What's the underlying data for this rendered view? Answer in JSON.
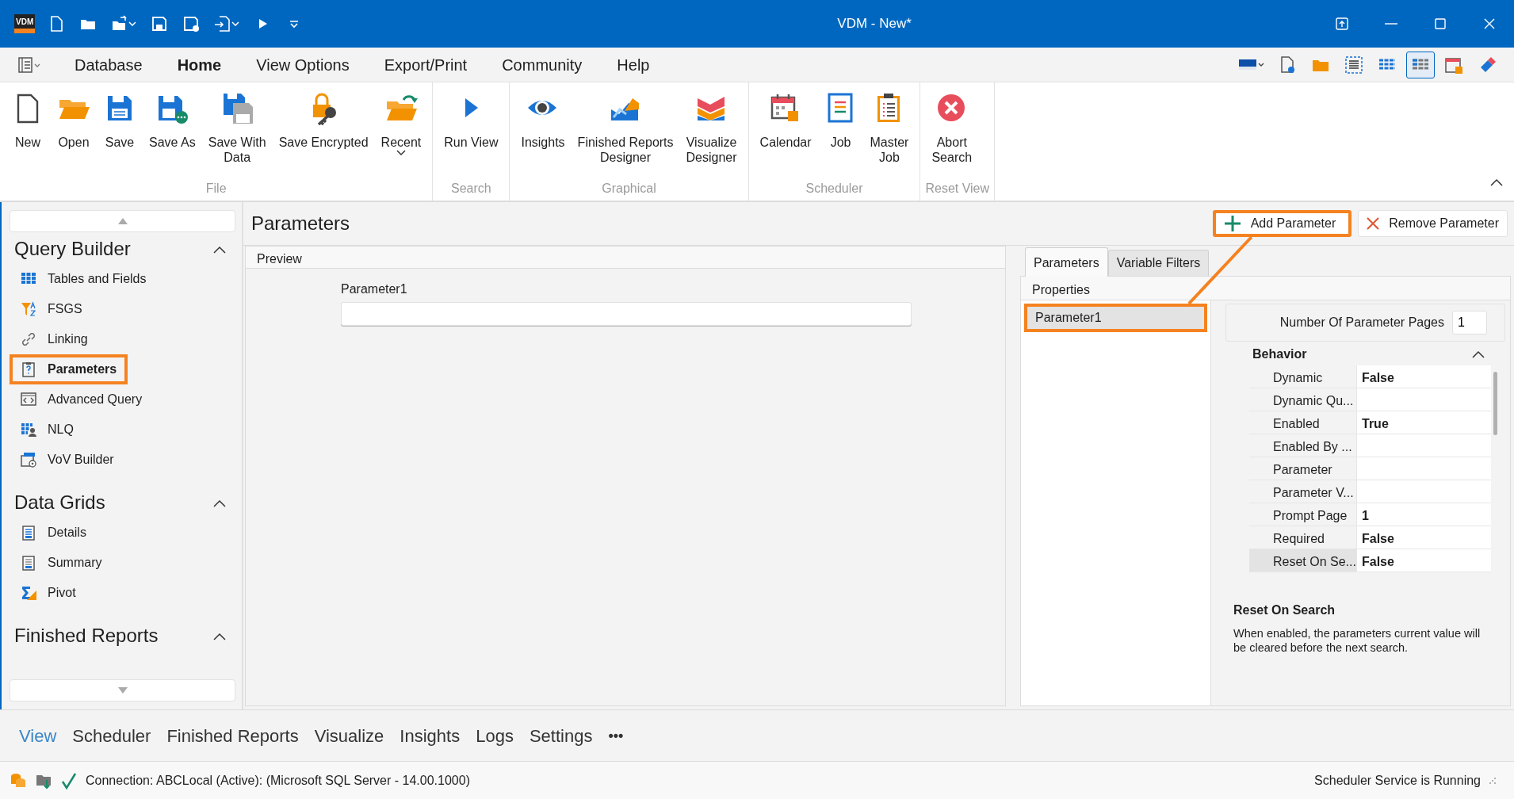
{
  "window": {
    "logo": "VDM",
    "title": "VDM - New*"
  },
  "menu": {
    "tabs": [
      {
        "label": "Database",
        "selected": false
      },
      {
        "label": "Home",
        "selected": true
      },
      {
        "label": "View Options",
        "selected": false
      },
      {
        "label": "Export/Print",
        "selected": false
      },
      {
        "label": "Community",
        "selected": false
      },
      {
        "label": "Help",
        "selected": false
      }
    ],
    "tools": [
      {
        "selected": false
      },
      {
        "selected": false
      },
      {
        "selected": false
      },
      {
        "selected": false
      },
      {
        "selected": false
      },
      {
        "selected": true
      },
      {
        "selected": false
      },
      {
        "selected": false
      }
    ]
  },
  "ribbon": {
    "groups": [
      {
        "caption": "File",
        "buttons": [
          {
            "label": "New"
          },
          {
            "label": "Open"
          },
          {
            "label": "Save"
          },
          {
            "label": "Save As"
          },
          {
            "label": "Save With\nData"
          },
          {
            "label": "Save Encrypted"
          },
          {
            "label": "Recent",
            "dropdown": true
          }
        ]
      },
      {
        "caption": "Search",
        "buttons": [
          {
            "label": "Run View"
          }
        ]
      },
      {
        "caption": "Graphical",
        "buttons": [
          {
            "label": "Insights"
          },
          {
            "label": "Finished Reports\nDesigner"
          },
          {
            "label": "Visualize\nDesigner"
          }
        ]
      },
      {
        "caption": "Scheduler",
        "buttons": [
          {
            "label": "Calendar"
          },
          {
            "label": "Job"
          },
          {
            "label": "Master\nJob"
          }
        ]
      },
      {
        "caption": "Reset View",
        "buttons": [
          {
            "label": "Abort\nSearch"
          }
        ]
      }
    ]
  },
  "sidebar": {
    "sections": [
      {
        "title": "Query Builder",
        "expanded": true,
        "items": [
          {
            "label": "Tables and Fields",
            "selected": false,
            "highlighted": false
          },
          {
            "label": "FSGS",
            "selected": false,
            "highlighted": false
          },
          {
            "label": "Linking",
            "selected": false,
            "highlighted": false
          },
          {
            "label": "Parameters",
            "selected": true,
            "highlighted": true
          },
          {
            "label": "Advanced Query",
            "selected": false,
            "highlighted": false
          },
          {
            "label": "NLQ",
            "selected": false,
            "highlighted": false
          },
          {
            "label": "VoV Builder",
            "selected": false,
            "highlighted": false
          }
        ]
      },
      {
        "title": "Data Grids",
        "expanded": true,
        "items": [
          {
            "label": "Details",
            "selected": false,
            "highlighted": false
          },
          {
            "label": "Summary",
            "selected": false,
            "highlighted": false
          },
          {
            "label": "Pivot",
            "selected": false,
            "highlighted": false
          }
        ]
      },
      {
        "title": "Finished Reports",
        "expanded": true
      }
    ]
  },
  "page": {
    "title": "Parameters",
    "actions": [
      {
        "label": "Add Parameter",
        "kind": "add",
        "highlighted": true
      },
      {
        "label": "Remove Parameter",
        "kind": "remove",
        "highlighted": false
      }
    ]
  },
  "preview": {
    "title": "Preview",
    "fields": [
      {
        "label": "Parameter1"
      }
    ]
  },
  "editor": {
    "tabs": [
      {
        "label": "Parameters",
        "selected": true
      },
      {
        "label": "Variable Filters",
        "selected": false
      }
    ],
    "header": "Properties",
    "parameters": [
      {
        "label": "Parameter1",
        "selected": true,
        "highlighted": true
      }
    ],
    "page_count": {
      "label": "Number Of Parameter Pages",
      "value": "1"
    },
    "category": {
      "title": "Behavior",
      "expanded": true
    },
    "properties": [
      {
        "name": "Dynamic",
        "value": "False",
        "selected": false
      },
      {
        "name": "Dynamic Qu...",
        "selected": false
      },
      {
        "name": "Enabled",
        "value": "True",
        "selected": false
      },
      {
        "name": "Enabled By ...",
        "selected": false
      },
      {
        "name": "Parameter",
        "selected": false
      },
      {
        "name": "Parameter V...",
        "selected": false
      },
      {
        "name": "Prompt Page",
        "value": "1",
        "selected": false
      },
      {
        "name": "Required",
        "value": "False",
        "selected": false
      },
      {
        "name": "Reset On Se...",
        "value": "False",
        "selected": true
      }
    ],
    "description": {
      "title": "Reset On Search",
      "text": "When enabled, the parameters current value will be cleared before the next search."
    }
  },
  "bottom_tabs": {
    "tabs": [
      {
        "label": "View",
        "selected": true
      },
      {
        "label": "Scheduler",
        "selected": false
      },
      {
        "label": "Finished Reports",
        "selected": false
      },
      {
        "label": "Visualize",
        "selected": false
      },
      {
        "label": "Insights",
        "selected": false
      },
      {
        "label": "Logs",
        "selected": false
      },
      {
        "label": "Settings",
        "selected": false
      }
    ],
    "more": "•••"
  },
  "status_bar": {
    "connection": "Connection: ABCLocal (Active): (Microsoft SQL Server - 14.00.1000)",
    "connected": true,
    "service": "Scheduler Service is Running"
  }
}
